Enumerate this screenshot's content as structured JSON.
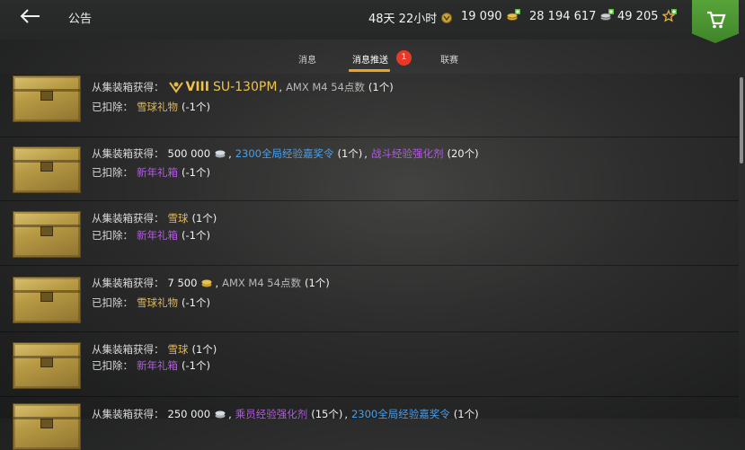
{
  "header": {
    "title": "公告",
    "duration": "48天 22小时",
    "credits": "19 090",
    "silver": "28 194 617",
    "free_xp": "49 205"
  },
  "tabs": [
    {
      "label": "消息"
    },
    {
      "label": "消息推送",
      "badge": "1",
      "active": true
    },
    {
      "label": "联赛"
    }
  ],
  "rows": [
    {
      "obtain_label": "从集装箱获得：",
      "tier": "VIII",
      "tank": "SU-130PM",
      "sep1": ",",
      "item1": "AMX M4 54点数",
      "count1": "(1个)",
      "deduct_label": "已扣除：",
      "deduct_item": "雪球礼物",
      "deduct_count": "(-1个)"
    },
    {
      "obtain_label": "从集装箱获得：",
      "amount": "500 000",
      "sep1": ",",
      "item1": "2300全局经验嘉奖令",
      "count1": "(1个)",
      "sep2": ",",
      "item2": "战斗经验强化剂",
      "count2": "(20个)",
      "deduct_label": "已扣除：",
      "deduct_item": "新年礼箱",
      "deduct_count": "(-1个)"
    },
    {
      "obtain_label": "从集装箱获得：",
      "item1": "雪球",
      "count1": "(1个)",
      "deduct_label": "已扣除：",
      "deduct_item": "新年礼箱",
      "deduct_count": "(-1个)"
    },
    {
      "obtain_label": "从集装箱获得：",
      "amount": "7 500",
      "sep1": ",",
      "item1": "AMX M4 54点数",
      "count1": "(1个)",
      "deduct_label": "已扣除：",
      "deduct_item": "雪球礼物",
      "deduct_count": "(-1个)"
    },
    {
      "obtain_label": "从集装箱获得：",
      "item1": "雪球",
      "count1": "(1个)",
      "deduct_label": "已扣除：",
      "deduct_item": "新年礼箱",
      "deduct_count": "(-1个)"
    },
    {
      "obtain_label": "从集装箱获得：",
      "amount": "250 000",
      "sep1": ",",
      "item1": "乘员经验强化剂",
      "count1": "(15个)",
      "sep2": ",",
      "item2": "2300全局经验嘉奖令",
      "count2": "(1个)"
    }
  ],
  "colors": {
    "accent_tab": "#f0a521",
    "badge": "#e53a2a",
    "cart": "#4f9a33",
    "gold_text": "#e6b74a",
    "blue_text": "#4a9fe8",
    "purple_text": "#b25ce0"
  },
  "icons": {
    "back": "back-arrow-icon",
    "premium": "premium-medal-icon",
    "gold": "gold-coins-icon",
    "silver": "silver-coins-icon",
    "xp": "star-icon",
    "cart": "shopping-cart-icon"
  }
}
